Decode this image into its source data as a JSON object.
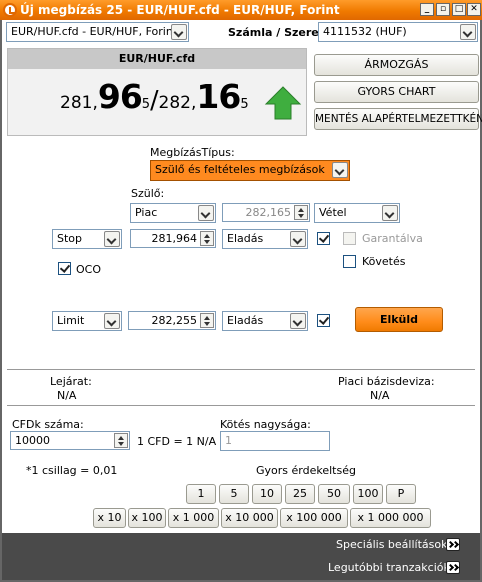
{
  "window": {
    "title": "Új megbízás 25 - EUR/HUF.cfd - EUR/HUF, Forint",
    "buttons": [
      "_",
      "▫",
      "□",
      "✕"
    ]
  },
  "header": {
    "instrument_select": "EUR/HUF.cfd - EUR/HUF, Forint",
    "account_label": "Számla / Szerep:",
    "account_select": "4111532 (HUF)"
  },
  "quote": {
    "symbol": "EUR/HUF.cfd",
    "bid_prefix": "281,",
    "bid_big": "96",
    "bid_small": "5",
    "separator": "/",
    "ask_prefix": "282,",
    "ask_big": "16",
    "ask_small": "5",
    "trend": "up"
  },
  "side_buttons": {
    "price_move": "ÁRMOZGÁS",
    "quick_chart": "GYORS CHART",
    "save_defaults": "MENTÉS ALAPÉRTELMEZETTKÉNT"
  },
  "order_type": {
    "label": "MegbízásTípus:",
    "value": "Szülő és feltételes megbízások"
  },
  "parent": {
    "label": "Szülő:",
    "type": "Piac",
    "price": "282,165",
    "side": "Vétel"
  },
  "stop": {
    "type": "Stop",
    "price": "281,964",
    "side": "Eladás",
    "checked": true,
    "guaranteed_label": "Garantálva",
    "follow_label": "Követés"
  },
  "oco": {
    "label": "OCO",
    "checked": true
  },
  "limit": {
    "type": "Limit",
    "price": "282,255",
    "side": "Eladás",
    "checked": true,
    "submit_label": "Elküld"
  },
  "expiry": {
    "label": "Lejárat:",
    "value": "N/A"
  },
  "base_currency": {
    "label": "Piaci bázisdeviza:",
    "value": "N/A"
  },
  "cfd_count": {
    "label": "CFDk száma:",
    "value": "10000",
    "conversion": "1 CFD = 1 N/A"
  },
  "trade_size": {
    "label": "Kötés nagysága:",
    "value": "1"
  },
  "star_note": "*1 csillag = 0,01",
  "quick_amount": {
    "label": "Gyors érdekeltség",
    "row1": [
      "1",
      "5",
      "10",
      "25",
      "50",
      "100",
      "P"
    ],
    "row2": [
      "x 10",
      "x 100",
      "x 1 000",
      "x 10 000",
      "x 100 000",
      "x 1 000 000"
    ]
  },
  "footer": {
    "special_settings": "Speciális beállítások:",
    "recent_transactions": "Legutóbbi tranzakciók:"
  },
  "colors": {
    "title_orange": "#f07a00",
    "order_type_bg": "#ff8a1f",
    "submit_orange": "#ff8c1a",
    "arrow_green": "#3fae3f",
    "footer_dark": "#4a4a4a",
    "quote_panel": "#f2f2f2"
  }
}
